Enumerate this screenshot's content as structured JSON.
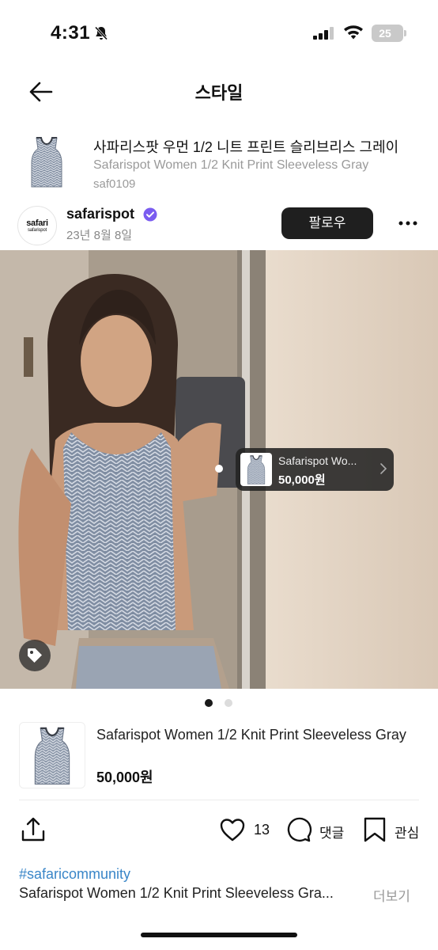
{
  "status_bar": {
    "time": "4:31",
    "battery": "25"
  },
  "header": {
    "title": "스타일"
  },
  "product": {
    "name_ko": "사파리스팟 우먼 1/2 니트 프린트 슬리브리스 그레이",
    "name_en": "Safarispot Women 1/2 Knit Print Sleeveless Gray",
    "code": "saf0109"
  },
  "author": {
    "avatar_line1": "safari",
    "avatar_line2": "safarispot",
    "name": "safarispot",
    "date": "23년 8월 8일",
    "follow_label": "팔로우"
  },
  "photo_tag": {
    "name": "Safarispot Wo...",
    "price": "50,000원"
  },
  "carousel": {
    "total": 2,
    "current": 1
  },
  "product_card": {
    "name": "Safarispot Women 1/2 Knit Print Sleeveless Gray",
    "price": "50,000원"
  },
  "actions": {
    "like_count": "13",
    "comment_label": "댓글",
    "save_label": "관심"
  },
  "post": {
    "hashtag": "#safaricommunity",
    "caption": "Safarispot Women 1/2 Knit Print Sleeveless Gra...",
    "more_label": "더보기"
  },
  "colors": {
    "hashtag": "#3a86c8",
    "follow_button": "#1f1f1f",
    "verified_badge": "#7a5cf0"
  },
  "icons": [
    "bell-slash-icon",
    "signal-icon",
    "wifi-icon",
    "battery-icon",
    "back-arrow-icon",
    "verified-badge-icon",
    "more-dots-icon",
    "tag-icon",
    "chevron-right-icon",
    "share-icon",
    "heart-icon",
    "comment-icon",
    "bookmark-icon"
  ]
}
